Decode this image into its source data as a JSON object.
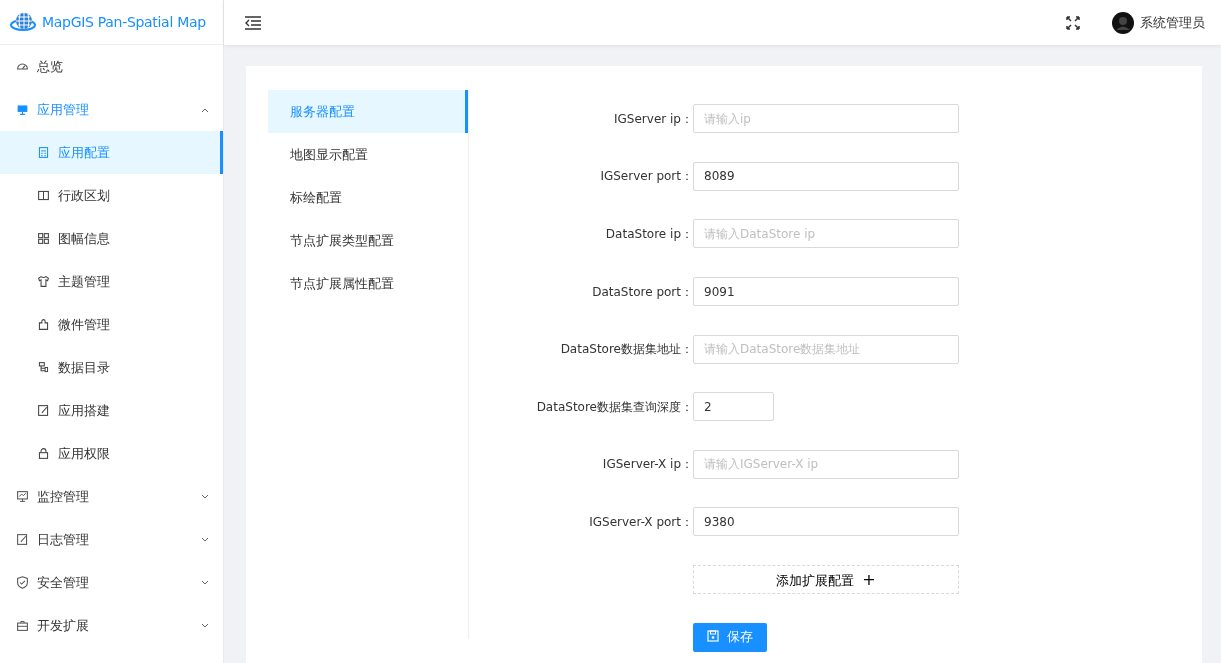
{
  "app": {
    "title": "MapGIS Pan-Spatial Map"
  },
  "header": {
    "user": "系统管理员"
  },
  "sidebar": {
    "items": [
      {
        "label": "总览",
        "selected": false
      },
      {
        "label": "应用管理",
        "expanded": true,
        "selected": true,
        "children": [
          {
            "label": "应用配置",
            "selected": true
          },
          {
            "label": "行政区划",
            "selected": false
          },
          {
            "label": "图幅信息",
            "selected": false
          },
          {
            "label": "主题管理",
            "selected": false
          },
          {
            "label": "微件管理",
            "selected": false
          },
          {
            "label": "数据目录",
            "selected": false
          },
          {
            "label": "应用搭建",
            "selected": false
          },
          {
            "label": "应用权限",
            "selected": false
          }
        ]
      },
      {
        "label": "监控管理",
        "expanded": false,
        "selected": false
      },
      {
        "label": "日志管理",
        "expanded": false,
        "selected": false
      },
      {
        "label": "安全管理",
        "expanded": false,
        "selected": false
      },
      {
        "label": "开发扩展",
        "expanded": false,
        "selected": false
      }
    ]
  },
  "config_tabs": [
    {
      "label": "服务器配置",
      "selected": true
    },
    {
      "label": "地图显示配置",
      "selected": false
    },
    {
      "label": "标绘配置",
      "selected": false
    },
    {
      "label": "节点扩展类型配置",
      "selected": false
    },
    {
      "label": "节点扩展属性配置",
      "selected": false
    }
  ],
  "form": {
    "fields": [
      {
        "label": "IGServer ip：",
        "placeholder": "请输入ip"
      },
      {
        "label": "IGServer port：",
        "value": "8089"
      },
      {
        "label": "DataStore ip：",
        "placeholder": "请输入DataStore ip"
      },
      {
        "label": "DataStore port：",
        "value": "9091"
      },
      {
        "label": "DataStore数据集地址：",
        "placeholder": "请输入DataStore数据集地址"
      },
      {
        "label": "DataStore数据集查询深度：",
        "value": "2",
        "kind": "short"
      },
      {
        "label": "IGServer-X ip：",
        "placeholder": "请输入IGServer-X ip"
      },
      {
        "label": "IGServer-X port：",
        "value": "9380"
      }
    ],
    "add_button": "添加扩展配置",
    "add_symbol": "+",
    "save_button": "保存"
  }
}
